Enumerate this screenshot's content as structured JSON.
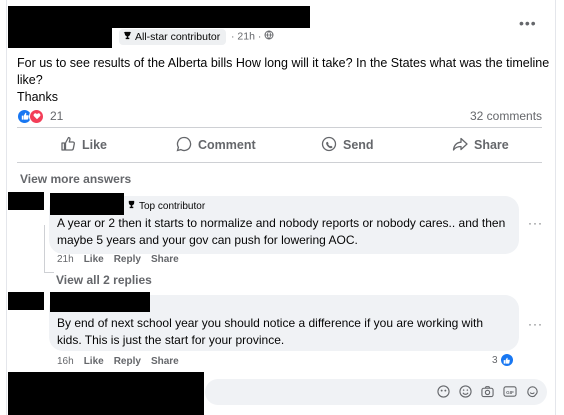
{
  "post": {
    "badge": "All-star contributor",
    "time": "21h",
    "lines": [
      "For us to see results of the Alberta bills How long will it take? In the States what was the timeline",
      "like?",
      "Thanks"
    ],
    "reaction_count": "21",
    "comment_count": "32 comments",
    "actions": {
      "like": "Like",
      "comment": "Comment",
      "send": "Send",
      "share": "Share"
    }
  },
  "view_more_answers": "View more answers",
  "comments": [
    {
      "badge": "Top contributor",
      "lines": [
        "A year or 2 then it starts to normalize and nobody reports or nobody cares.. and then",
        "maybe 5 years and your gov can push for lowering AOC."
      ],
      "time": "21h",
      "like": "Like",
      "reply": "Reply",
      "share": "Share"
    },
    {
      "lines": [
        "By end of next school year you should notice a difference if you are working with",
        "kids. This is just the start for your province."
      ],
      "time": "16h",
      "like": "Like",
      "reply": "Reply",
      "share": "Share",
      "reaction_count": "3"
    }
  ],
  "view_all_replies": "View all 2 replies",
  "colors": {
    "accent": "#1877f2",
    "love": "#f33e58",
    "bubble": "#f0f2f5",
    "muted": "#65676b"
  },
  "icons": [
    "trophy-icon",
    "globe-icon",
    "like-icon",
    "comment-icon",
    "send-icon",
    "share-icon",
    "emoji-icon",
    "camera-icon",
    "gif-icon",
    "sticker-icon",
    "avatar-icon"
  ]
}
